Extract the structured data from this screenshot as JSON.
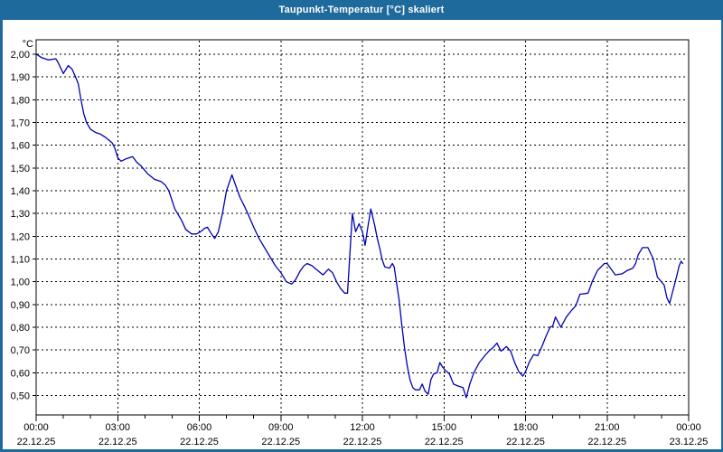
{
  "window": {
    "title": "Taupunkt-Temperatur [°C] skaliert"
  },
  "colors": {
    "titlebar": "#1e6a9d",
    "window_border": "#1e6a9d",
    "plot_background": "#ffffff",
    "grid": "#000000",
    "axis": "#000000",
    "text": "#000000",
    "line": "#0000b4"
  },
  "chart_data": {
    "type": "line",
    "title": "Taupunkt-Temperatur [°C] skaliert",
    "xlabel": "",
    "ylabel": "°C",
    "grid": true,
    "legend": "none",
    "y_axis": {
      "unit_label": "°C",
      "min": 0.5,
      "max": 2.0,
      "step": 0.1,
      "ticks": [
        {
          "v": 2.0,
          "label": "2,00"
        },
        {
          "v": 1.9,
          "label": "1,90"
        },
        {
          "v": 1.8,
          "label": "1,80"
        },
        {
          "v": 1.7,
          "label": "1,70"
        },
        {
          "v": 1.6,
          "label": "1,60"
        },
        {
          "v": 1.5,
          "label": "1,50"
        },
        {
          "v": 1.4,
          "label": "1,40"
        },
        {
          "v": 1.3,
          "label": "1,30"
        },
        {
          "v": 1.2,
          "label": "1,20"
        },
        {
          "v": 1.1,
          "label": "1,10"
        },
        {
          "v": 1.0,
          "label": "1,00"
        },
        {
          "v": 0.9,
          "label": "0,90"
        },
        {
          "v": 0.8,
          "label": "0,80"
        },
        {
          "v": 0.7,
          "label": "0,70"
        },
        {
          "v": 0.6,
          "label": "0,60"
        },
        {
          "v": 0.5,
          "label": "0,50"
        }
      ]
    },
    "x_axis": {
      "min_hour": 0,
      "max_hour": 24,
      "major_step_hours": 3,
      "minor_step_hours": 1,
      "ticks": [
        {
          "hour": 0,
          "time": "00:00",
          "date": "22.12.25"
        },
        {
          "hour": 3,
          "time": "03:00",
          "date": "22.12.25"
        },
        {
          "hour": 6,
          "time": "06:00",
          "date": "22.12.25"
        },
        {
          "hour": 9,
          "time": "09:00",
          "date": "22.12.25"
        },
        {
          "hour": 12,
          "time": "12:00",
          "date": "22.12.25"
        },
        {
          "hour": 15,
          "time": "15:00",
          "date": "22.12.25"
        },
        {
          "hour": 18,
          "time": "18:00",
          "date": "22.12.25"
        },
        {
          "hour": 21,
          "time": "21:00",
          "date": "22.12.25"
        },
        {
          "hour": 24,
          "time": "00:00",
          "date": "23.12.25"
        }
      ]
    },
    "series": [
      {
        "name": "Taupunkt-Temperatur",
        "color": "#0000b4",
        "points": [
          [
            0.0,
            2.0
          ],
          [
            0.08,
            1.995
          ],
          [
            0.2,
            1.985
          ],
          [
            0.45,
            1.975
          ],
          [
            0.72,
            1.98
          ],
          [
            0.8,
            1.965
          ],
          [
            1.0,
            1.915
          ],
          [
            1.18,
            1.95
          ],
          [
            1.32,
            1.935
          ],
          [
            1.45,
            1.9
          ],
          [
            1.55,
            1.87
          ],
          [
            1.65,
            1.8
          ],
          [
            1.75,
            1.74
          ],
          [
            1.85,
            1.7
          ],
          [
            2.0,
            1.67
          ],
          [
            2.2,
            1.655
          ],
          [
            2.35,
            1.65
          ],
          [
            2.55,
            1.635
          ],
          [
            2.8,
            1.61
          ],
          [
            2.9,
            1.585
          ],
          [
            3.0,
            1.545
          ],
          [
            3.12,
            1.53
          ],
          [
            3.3,
            1.54
          ],
          [
            3.55,
            1.55
          ],
          [
            3.7,
            1.525
          ],
          [
            3.85,
            1.51
          ],
          [
            4.1,
            1.475
          ],
          [
            4.35,
            1.45
          ],
          [
            4.6,
            1.44
          ],
          [
            4.75,
            1.425
          ],
          [
            4.88,
            1.4
          ],
          [
            5.1,
            1.32
          ],
          [
            5.35,
            1.27
          ],
          [
            5.5,
            1.23
          ],
          [
            5.72,
            1.21
          ],
          [
            5.9,
            1.21
          ],
          [
            6.05,
            1.22
          ],
          [
            6.2,
            1.235
          ],
          [
            6.3,
            1.24
          ],
          [
            6.45,
            1.21
          ],
          [
            6.57,
            1.19
          ],
          [
            6.7,
            1.22
          ],
          [
            6.85,
            1.3
          ],
          [
            7.0,
            1.4
          ],
          [
            7.2,
            1.47
          ],
          [
            7.35,
            1.42
          ],
          [
            7.5,
            1.37
          ],
          [
            7.67,
            1.33
          ],
          [
            7.82,
            1.29
          ],
          [
            8.0,
            1.24
          ],
          [
            8.2,
            1.19
          ],
          [
            8.35,
            1.16
          ],
          [
            8.6,
            1.11
          ],
          [
            8.8,
            1.07
          ],
          [
            9.0,
            1.04
          ],
          [
            9.2,
            1.0
          ],
          [
            9.4,
            0.99
          ],
          [
            9.55,
            1.01
          ],
          [
            9.7,
            1.045
          ],
          [
            9.85,
            1.07
          ],
          [
            9.97,
            1.08
          ],
          [
            10.15,
            1.07
          ],
          [
            10.35,
            1.05
          ],
          [
            10.55,
            1.03
          ],
          [
            10.75,
            1.055
          ],
          [
            10.9,
            1.04
          ],
          [
            11.05,
            1.0
          ],
          [
            11.2,
            0.97
          ],
          [
            11.35,
            0.95
          ],
          [
            11.45,
            0.95
          ],
          [
            11.63,
            1.3
          ],
          [
            11.75,
            1.22
          ],
          [
            11.88,
            1.255
          ],
          [
            12.0,
            1.22
          ],
          [
            12.1,
            1.16
          ],
          [
            12.2,
            1.24
          ],
          [
            12.31,
            1.32
          ],
          [
            12.45,
            1.25
          ],
          [
            12.55,
            1.19
          ],
          [
            12.65,
            1.14
          ],
          [
            12.72,
            1.1
          ],
          [
            12.82,
            1.065
          ],
          [
            13.0,
            1.06
          ],
          [
            13.1,
            1.08
          ],
          [
            13.17,
            1.065
          ],
          [
            13.25,
            1.0
          ],
          [
            13.35,
            0.92
          ],
          [
            13.45,
            0.81
          ],
          [
            13.55,
            0.71
          ],
          [
            13.65,
            0.63
          ],
          [
            13.75,
            0.57
          ],
          [
            13.85,
            0.535
          ],
          [
            13.95,
            0.525
          ],
          [
            14.1,
            0.525
          ],
          [
            14.2,
            0.55
          ],
          [
            14.3,
            0.52
          ],
          [
            14.42,
            0.505
          ],
          [
            14.52,
            0.57
          ],
          [
            14.62,
            0.595
          ],
          [
            14.75,
            0.6
          ],
          [
            14.85,
            0.645
          ],
          [
            14.95,
            0.625
          ],
          [
            15.05,
            0.61
          ],
          [
            15.2,
            0.595
          ],
          [
            15.35,
            0.55
          ],
          [
            15.55,
            0.54
          ],
          [
            15.7,
            0.535
          ],
          [
            15.82,
            0.49
          ],
          [
            15.95,
            0.55
          ],
          [
            16.1,
            0.6
          ],
          [
            16.3,
            0.645
          ],
          [
            16.5,
            0.675
          ],
          [
            16.65,
            0.695
          ],
          [
            16.8,
            0.71
          ],
          [
            16.95,
            0.73
          ],
          [
            17.1,
            0.695
          ],
          [
            17.3,
            0.715
          ],
          [
            17.45,
            0.695
          ],
          [
            17.6,
            0.645
          ],
          [
            17.75,
            0.605
          ],
          [
            17.9,
            0.585
          ],
          [
            18.0,
            0.605
          ],
          [
            18.15,
            0.65
          ],
          [
            18.3,
            0.68
          ],
          [
            18.45,
            0.675
          ],
          [
            18.6,
            0.715
          ],
          [
            18.75,
            0.76
          ],
          [
            18.9,
            0.8
          ],
          [
            19.0,
            0.805
          ],
          [
            19.1,
            0.845
          ],
          [
            19.3,
            0.8
          ],
          [
            19.5,
            0.845
          ],
          [
            19.7,
            0.875
          ],
          [
            19.85,
            0.895
          ],
          [
            20.0,
            0.945
          ],
          [
            20.3,
            0.95
          ],
          [
            20.45,
            1.0
          ],
          [
            20.65,
            1.05
          ],
          [
            20.9,
            1.08
          ],
          [
            21.0,
            1.08
          ],
          [
            21.15,
            1.055
          ],
          [
            21.3,
            1.03
          ],
          [
            21.55,
            1.035
          ],
          [
            21.75,
            1.05
          ],
          [
            21.95,
            1.06
          ],
          [
            22.05,
            1.08
          ],
          [
            22.15,
            1.12
          ],
          [
            22.3,
            1.15
          ],
          [
            22.5,
            1.15
          ],
          [
            22.7,
            1.1
          ],
          [
            22.85,
            1.02
          ],
          [
            23.0,
            1.0
          ],
          [
            23.1,
            0.985
          ],
          [
            23.2,
            0.93
          ],
          [
            23.3,
            0.905
          ],
          [
            23.45,
            0.975
          ],
          [
            23.55,
            1.02
          ],
          [
            23.65,
            1.07
          ],
          [
            23.72,
            1.09
          ],
          [
            23.78,
            1.08
          ]
        ]
      }
    ]
  }
}
